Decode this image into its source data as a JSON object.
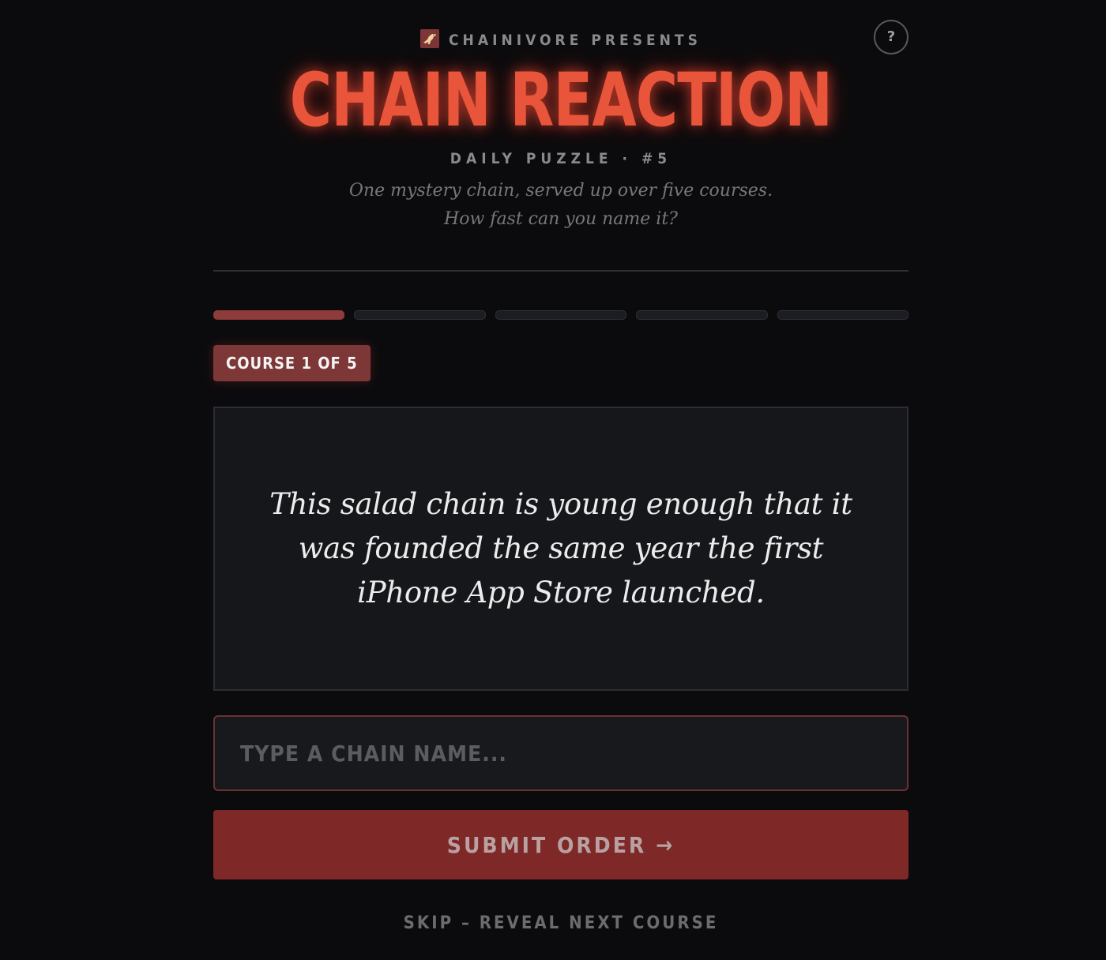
{
  "header": {
    "presents": "CHAINIVORE PRESENTS",
    "title": "CHAIN REACTION",
    "subtitle": "DAILY PUZZLE · #5",
    "tagline_line1": "One mystery chain, served up over five courses.",
    "tagline_line2": "How fast can you name it?",
    "logo_icon": "dinosaur-icon",
    "help_label": "?"
  },
  "progress": {
    "total": 5,
    "current": 1,
    "segments": [
      "active",
      "pending",
      "pending",
      "pending",
      "pending"
    ]
  },
  "course_badge": "COURSE 1 OF 5",
  "clue": "This salad chain is young enough that it was founded the same year the first iPhone App Store launched.",
  "answer": {
    "value": "",
    "placeholder": "TYPE A CHAIN NAME..."
  },
  "submit_label": "SUBMIT ORDER →",
  "skip_label": "SKIP – REVEAL NEXT COURSE",
  "colors": {
    "background": "#0b0b0d",
    "accent": "#e8553a",
    "badge": "#7e3737",
    "submit": "#7e2828"
  }
}
